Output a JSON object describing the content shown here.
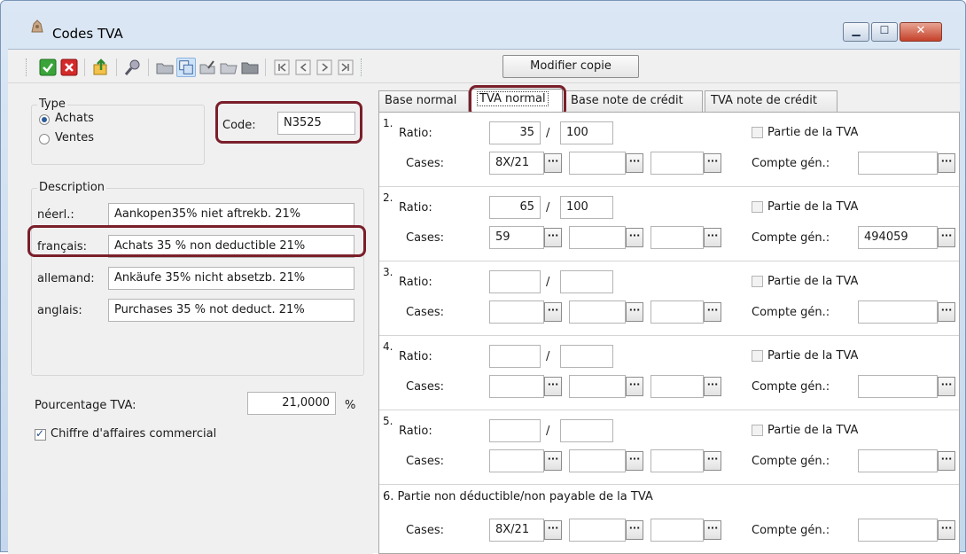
{
  "window": {
    "title": "Codes TVA",
    "controls": [
      "minimize",
      "maximize",
      "close"
    ]
  },
  "toolbar": {
    "icons": [
      "check-icon",
      "cancel-icon",
      "export-icon",
      "search-icon",
      "folder-icon",
      "copy-icon",
      "edit-icon",
      "folder-open-icon",
      "folder-closed-icon",
      "first-icon",
      "prev-icon",
      "next-icon",
      "last-icon"
    ],
    "modify_label": "Modifier copie"
  },
  "type_group": {
    "title": "Type",
    "options": [
      "Achats",
      "Ventes"
    ],
    "selected": "Achats"
  },
  "code": {
    "label": "Code:",
    "value": "N3525"
  },
  "description": {
    "title": "Description",
    "rows": [
      {
        "label": "néerl.:",
        "value": "Aankopen35% niet aftrekb. 21%"
      },
      {
        "label": "français:",
        "value": "Achats 35 % non deductible 21%"
      },
      {
        "label": "allemand:",
        "value": "Ankäufe 35% nicht absetzb. 21%"
      },
      {
        "label": "anglais:",
        "value": "Purchases 35 % not deduct. 21%"
      }
    ]
  },
  "pourcentage": {
    "label": "Pourcentage TVA:",
    "value": "21,0000",
    "unit": "%"
  },
  "chiffre": {
    "label": "Chiffre d'affaires commercial",
    "checked": true
  },
  "tabs": [
    {
      "label": "Base normal"
    },
    {
      "label": "TVA normal",
      "active": true
    },
    {
      "label": "Base note de crédit"
    },
    {
      "label": "TVA note de crédit"
    }
  ],
  "labels": {
    "ratio": "Ratio:",
    "cases": "Cases:",
    "compte": "Compte gén.:",
    "partie": "Partie de la TVA",
    "slash": "/",
    "ellipsis": "···"
  },
  "sections": [
    {
      "num": "1.",
      "ratio_num": "35",
      "ratio_den": "100",
      "case1": "8X/21",
      "case2": "",
      "case3": "",
      "compte": ""
    },
    {
      "num": "2.",
      "ratio_num": "65",
      "ratio_den": "100",
      "case1": "59",
      "case2": "",
      "case3": "",
      "compte": "494059"
    },
    {
      "num": "3.",
      "ratio_num": "",
      "ratio_den": "",
      "case1": "",
      "case2": "",
      "case3": "",
      "compte": ""
    },
    {
      "num": "4.",
      "ratio_num": "",
      "ratio_den": "",
      "case1": "",
      "case2": "",
      "case3": "",
      "compte": ""
    },
    {
      "num": "5.",
      "ratio_num": "",
      "ratio_den": "",
      "case1": "",
      "case2": "",
      "case3": "",
      "compte": ""
    }
  ],
  "section6": {
    "title": "6. Partie non déductible/non payable de la TVA",
    "case1": "8X/21",
    "case2": "",
    "case3": "",
    "compte": ""
  },
  "colors": {
    "highlight": "#7a1f2a",
    "window_frame": "#c4d7ec",
    "close_button": "#c5412a"
  }
}
